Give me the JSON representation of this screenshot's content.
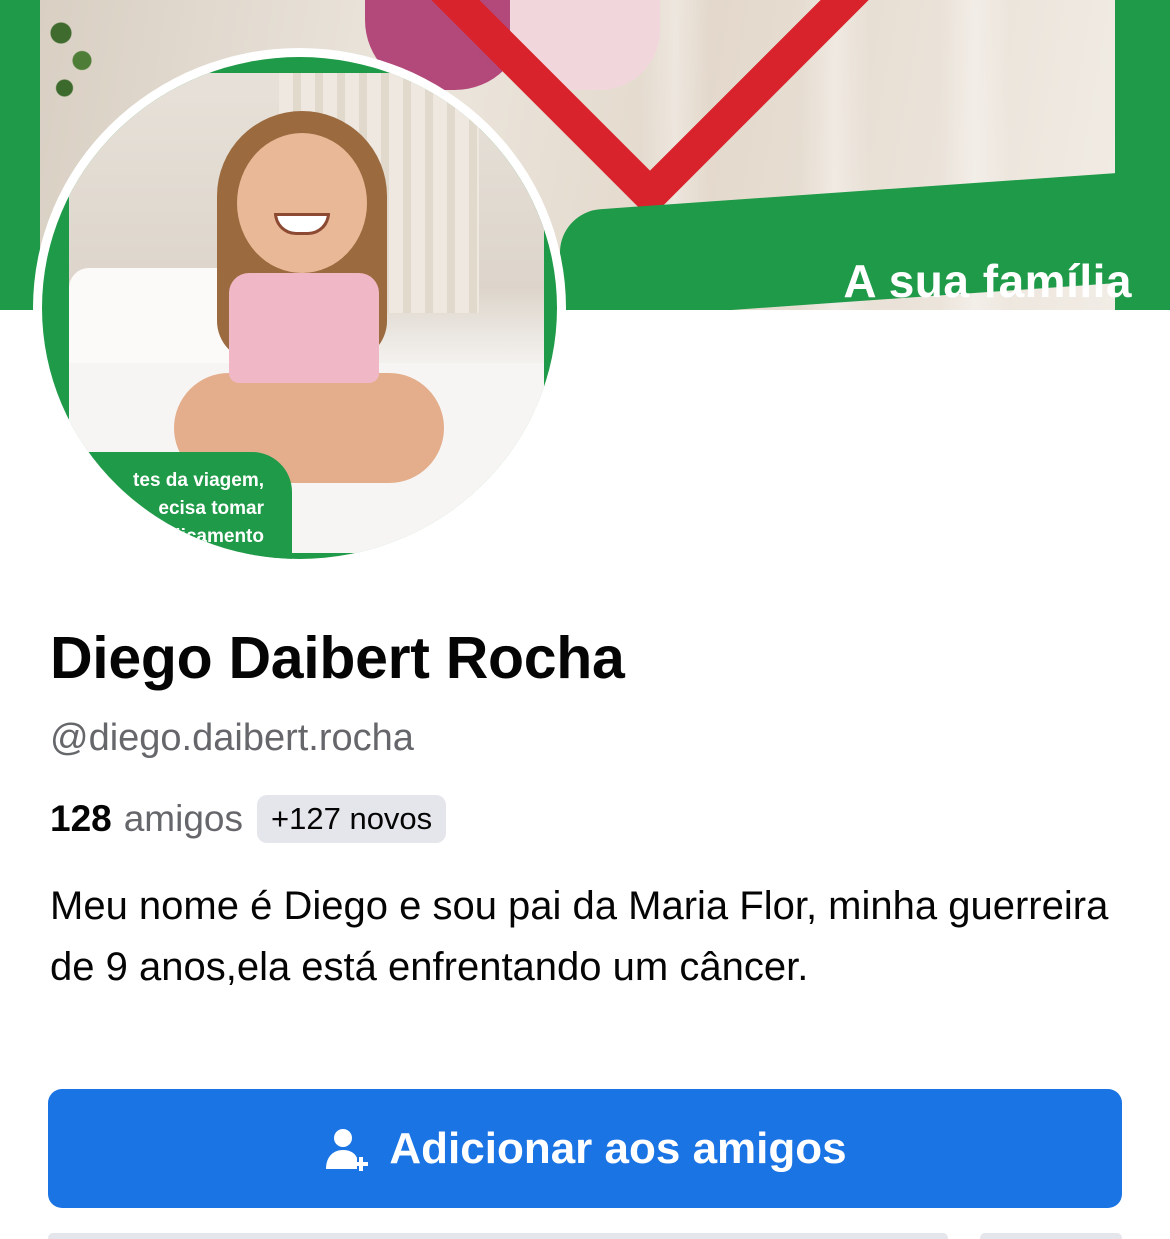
{
  "cover": {
    "caption": "A sua família"
  },
  "avatar": {
    "tag_lines": [
      "tes da viagem,",
      "ecisa tomar",
      "licamento"
    ]
  },
  "profile": {
    "name": "Diego Daibert Rocha",
    "handle": "@diego.daibert.rocha",
    "friends_count": "128",
    "friends_label": "amigos",
    "new_friends_badge": "+127 novos",
    "bio": "Meu nome é Diego e sou pai da Maria Flor, minha guerreira de 9 anos,ela está enfrentando um câncer."
  },
  "actions": {
    "add_friend_label": "Adicionar aos amigos",
    "add_friend_icon": "add-person-icon",
    "button_color": "#1b74e4"
  },
  "colors": {
    "brand_green": "#1e9a48",
    "accent_red": "#d9232c"
  }
}
